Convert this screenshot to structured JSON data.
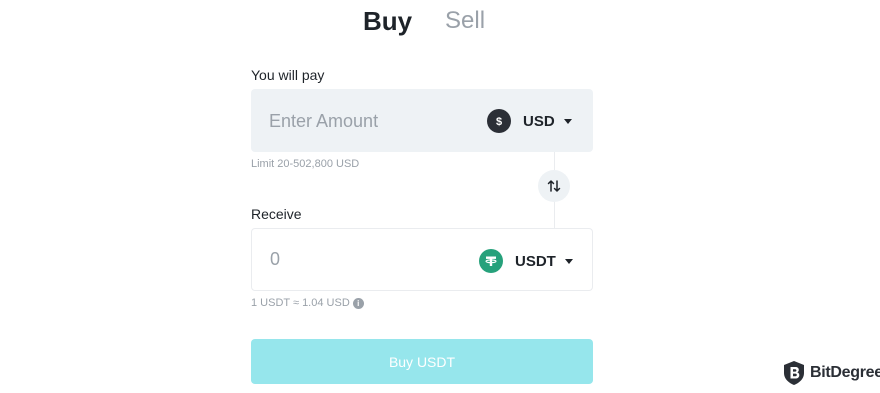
{
  "tabs": {
    "buy": "Buy",
    "sell": "Sell"
  },
  "pay": {
    "label": "You will pay",
    "placeholder": "Enter Amount",
    "currency": "USD",
    "coin_icon": "dollar-coin-icon",
    "limit": "Limit 20-502,800 USD"
  },
  "receive": {
    "label": "Receive",
    "value": "0",
    "currency": "USDT",
    "coin_icon": "tether-coin-icon",
    "rate": "1 USDT ≈ 1.04 USD"
  },
  "action": {
    "button_label": "Buy USDT"
  },
  "brand": {
    "name": "BitDegree"
  },
  "colors": {
    "accent_button": "#96e6ec",
    "input_bg": "#eef2f5",
    "tether_green": "#26a17b",
    "text_primary": "#1e2329",
    "text_muted": "#9aa1a9"
  }
}
